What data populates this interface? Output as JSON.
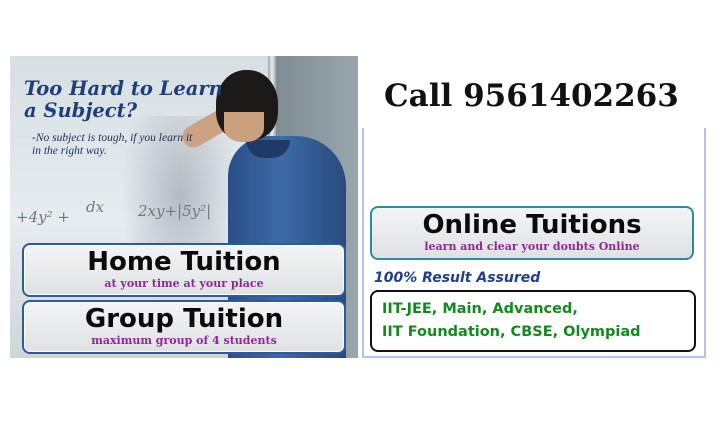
{
  "poster": {
    "headline": "Too Hard to Learn a Subject?",
    "subline": "-No subject is tough, if you learn it in the right way.",
    "board_scribbles": [
      "+4y² +",
      "dx",
      "2xy+|5y²|"
    ],
    "home_tuition": {
      "title": "Home Tuition",
      "tagline": "at your time at your place"
    },
    "group_tuition": {
      "title": "Group Tuition",
      "tagline": "maximum group of 4 students"
    },
    "call": "Call 9561402263",
    "online_tuitions": {
      "title": "Online Tuitions",
      "tagline": "learn and clear your doubts Online"
    },
    "assured": "100% Result Assured",
    "courses": [
      "IIT-JEE, Main, Advanced,",
      "IIT Foundation, CBSE, Olympiad"
    ]
  },
  "colors": {
    "headline": "#1f3f7a",
    "tagline": "#8b2a94",
    "course_text": "#138a1e",
    "assured_text": "#1f3f8a",
    "box_border_left": "#2d5a9f",
    "box_border_online": "#2d8a9f",
    "panel_border": "#b6c2ee"
  },
  "images": {
    "photo": "student-leaning-head-on-whiteboard"
  }
}
